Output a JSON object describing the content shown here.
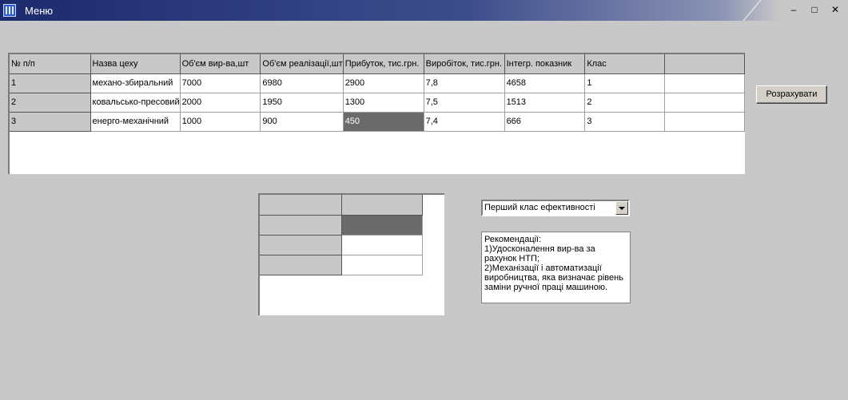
{
  "window": {
    "title": "Меню"
  },
  "main_grid": {
    "headers": [
      "№ п/п",
      "Назва цеху",
      "Об'єм вир-ва,шт",
      "Об'єм реалізації,шт",
      "Прибуток, тис.грн.",
      "Виробіток, тис.грн.",
      "Інтегр. показник",
      "Клас",
      ""
    ],
    "rows": [
      [
        "1",
        "механо-збиральний",
        "7000",
        "6980",
        "2900",
        "7,8",
        "4658",
        "1",
        ""
      ],
      [
        "2",
        "ковальсько-пресовий",
        "2000",
        "1950",
        "1300",
        "7,5",
        "1513",
        "2",
        ""
      ],
      [
        "3",
        "енерго-механічний",
        "1000",
        "900",
        "450",
        "7,4",
        "666",
        "3",
        ""
      ]
    ],
    "selected_cell": "450"
  },
  "calculate_button": {
    "label": "Розрахувати"
  },
  "class_select": {
    "value": "Перший клас ефективності"
  },
  "recommendations": {
    "text": "Рекомендації:\n1)Удосконалення вир-ва за рахунок НТП;\n2)Механізації і автоматизації виробництва, яка визначає рівень заміни ручної праці машиною."
  }
}
